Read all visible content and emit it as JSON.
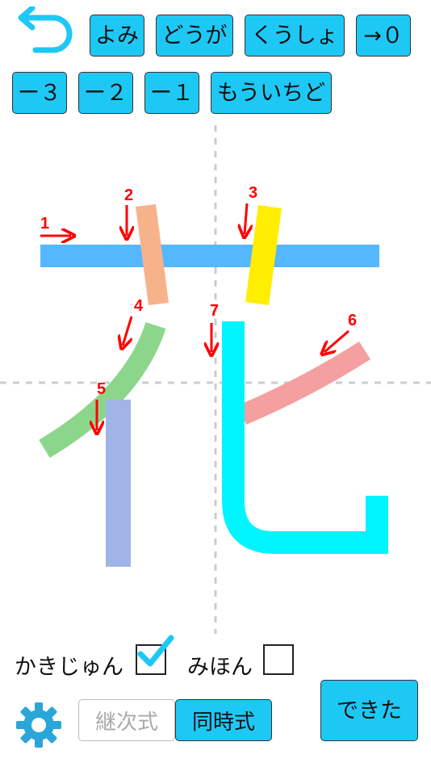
{
  "toolbar": {
    "reading": "よみ",
    "animation": "どうが",
    "stroke_order_detail": "くうしょ",
    "to_zero": "→０",
    "minus3": "ー３",
    "minus2": "ー２",
    "minus1": "ー１",
    "again": "もういちど"
  },
  "stroke_numbers": [
    "1",
    "2",
    "3",
    "4",
    "5",
    "6",
    "7"
  ],
  "options": {
    "stroke_order_label": "かきじゅん",
    "stroke_order_checked": true,
    "model_label": "みほん",
    "model_checked": false
  },
  "mode": {
    "sequential": "継次式",
    "simultaneous": "同時式",
    "selected": "simultaneous"
  },
  "done_label": "できた",
  "colors": {
    "button": "#1ec8f5",
    "stroke1": "#55b8ff",
    "stroke2": "#f6b38a",
    "stroke3": "#ffee00",
    "stroke4": "#8cd68c",
    "stroke5": "#a0b4e8",
    "stroke6": "#f4a0a0",
    "stroke7": "#00f5ff",
    "arrow": "#ff0000"
  },
  "icons": {
    "back": "undo-arrow-icon",
    "settings": "gear-icon",
    "check": "checkmark-icon"
  }
}
